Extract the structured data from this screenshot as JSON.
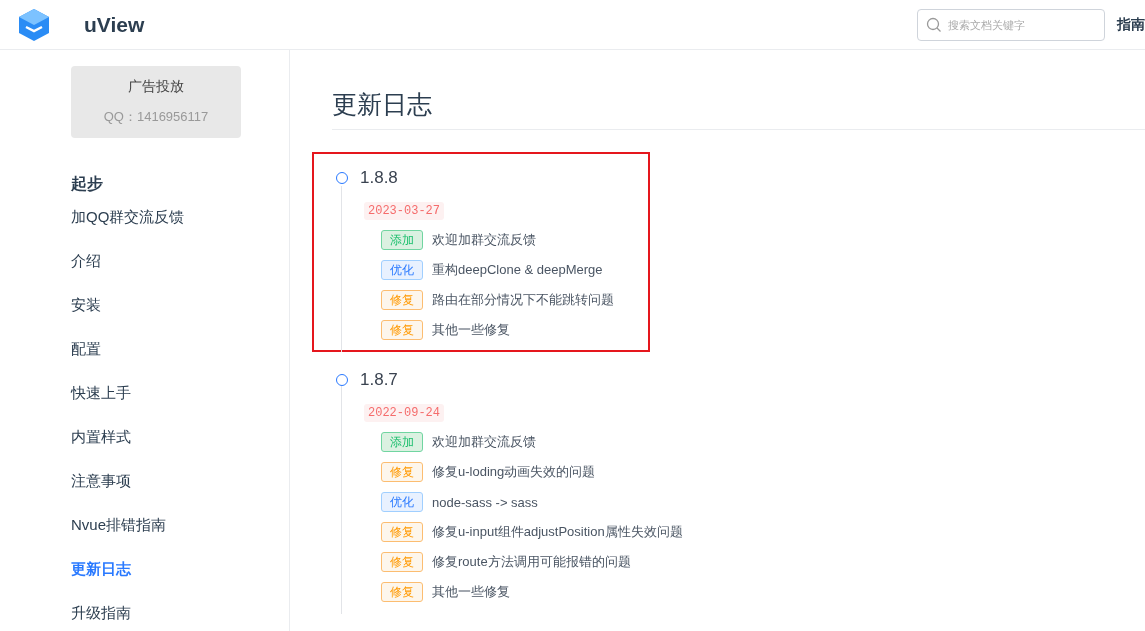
{
  "header": {
    "brand": "uView",
    "search": {
      "placeholder": "搜索文档关键字"
    },
    "nav": [
      "指南"
    ]
  },
  "sidebar": {
    "ad": {
      "title": "广告投放",
      "contact": "QQ：1416956117"
    },
    "section": "起步",
    "items": [
      {
        "label": "加QQ群交流反馈",
        "selected": false
      },
      {
        "label": "介绍",
        "selected": false
      },
      {
        "label": "安装",
        "selected": false
      },
      {
        "label": "配置",
        "selected": false
      },
      {
        "label": "快速上手",
        "selected": false
      },
      {
        "label": "内置样式",
        "selected": false
      },
      {
        "label": "注意事项",
        "selected": false
      },
      {
        "label": "Nvue排错指南",
        "selected": false
      },
      {
        "label": "更新日志",
        "selected": true
      },
      {
        "label": "升级指南",
        "selected": false
      }
    ]
  },
  "page": {
    "title": "更新日志",
    "releases": [
      {
        "version": "1.8.8",
        "date": "2023-03-27",
        "highlighted": true,
        "changes": [
          {
            "kind": "add",
            "tag": "添加",
            "text": "欢迎加群交流反馈"
          },
          {
            "kind": "optimize",
            "tag": "优化",
            "text": "重构deepClone & deepMerge"
          },
          {
            "kind": "fix",
            "tag": "修复",
            "text": "路由在部分情况下不能跳转问题"
          },
          {
            "kind": "fix",
            "tag": "修复",
            "text": "其他一些修复"
          }
        ]
      },
      {
        "version": "1.8.7",
        "date": "2022-09-24",
        "highlighted": false,
        "changes": [
          {
            "kind": "add",
            "tag": "添加",
            "text": "欢迎加群交流反馈"
          },
          {
            "kind": "fix",
            "tag": "修复",
            "text": "修复u-loding动画失效的问题"
          },
          {
            "kind": "optimize",
            "tag": "优化",
            "text": "node-sass -> sass"
          },
          {
            "kind": "fix",
            "tag": "修复",
            "text": "修复u-input组件adjustPosition属性失效问题"
          },
          {
            "kind": "fix",
            "tag": "修复",
            "text": "修复route方法调用可能报错的问题"
          },
          {
            "kind": "fix",
            "tag": "修复",
            "text": "其他一些修复"
          }
        ]
      }
    ]
  }
}
